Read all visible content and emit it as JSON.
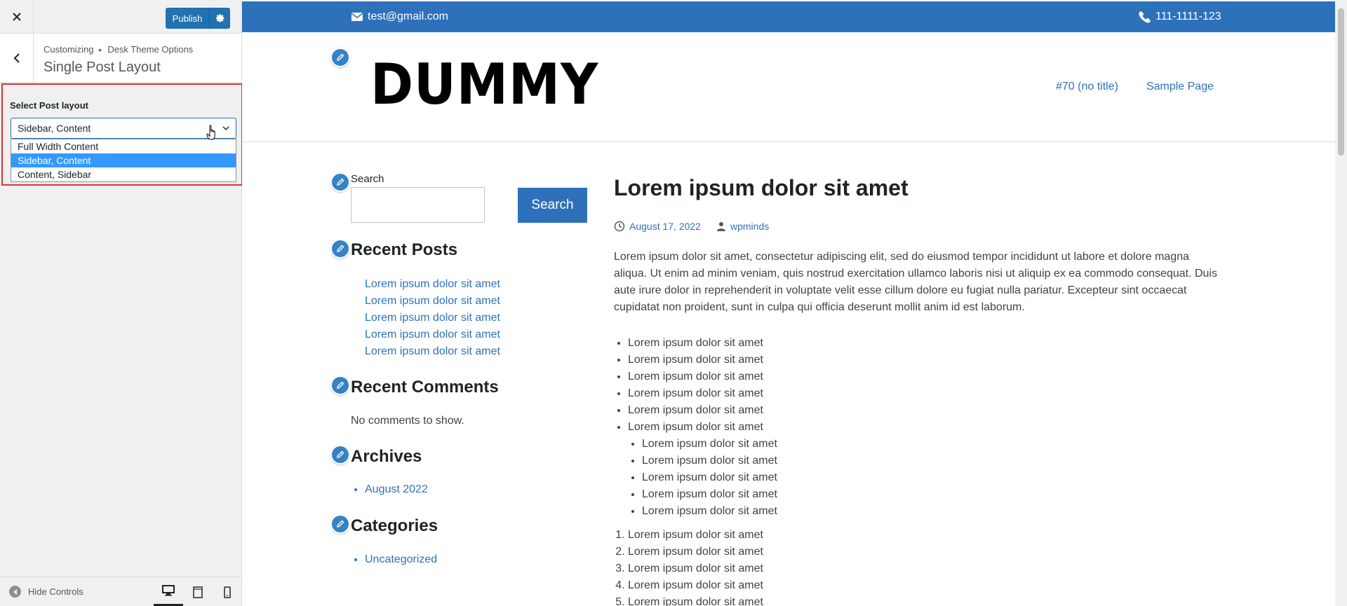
{
  "customizer": {
    "publish_label": "Publish",
    "breadcrumb": {
      "root": "Customizing",
      "separator": "▸",
      "parent": "Desk Theme Options"
    },
    "section_title": "Single Post Layout",
    "control_label": "Select Post layout",
    "select_value": "Sidebar, Content",
    "options": [
      {
        "label": "Full Width Content",
        "selected": false
      },
      {
        "label": "Sidebar, Content",
        "selected": true
      },
      {
        "label": "Content, Sidebar",
        "selected": false
      }
    ],
    "hide_controls_label": "Hide Controls",
    "devices": [
      "desktop-icon",
      "tablet-icon",
      "mobile-icon"
    ]
  },
  "site": {
    "email": "test@gmail.com",
    "phone": "111-1111-123",
    "logo": "DUMMY",
    "nav": [
      "#70 (no title)",
      "Sample Page"
    ],
    "accent_color": "#2e71bb"
  },
  "sidebar": {
    "search_label": "Search",
    "search_button": "Search",
    "recent_posts_title": "Recent Posts",
    "recent_posts": [
      "Lorem ipsum dolor sit amet",
      "Lorem ipsum dolor sit amet",
      "Lorem ipsum dolor sit amet",
      "Lorem ipsum dolor sit amet",
      "Lorem ipsum dolor sit amet"
    ],
    "recent_comments_title": "Recent Comments",
    "no_comments": "No comments to show.",
    "archives_title": "Archives",
    "archives": [
      "August 2022"
    ],
    "categories_title": "Categories",
    "categories": [
      "Uncategorized"
    ]
  },
  "post": {
    "title": "Lorem ipsum dolor sit amet",
    "date": "August 17, 2022",
    "author": "wpminds",
    "body": "Lorem ipsum dolor sit amet, consectetur adipiscing elit, sed do eiusmod tempor incididunt ut labore et dolore magna aliqua. Ut enim ad minim veniam, quis nostrud exercitation ullamco laboris nisi ut aliquip ex ea commodo consequat. Duis aute irure dolor in reprehenderit in voluptate velit esse cillum dolore eu fugiat nulla pariatur. Excepteur sint occaecat cupidatat non proident, sunt in culpa qui officia deserunt mollit anim id est laborum.",
    "ul_items": [
      "Lorem ipsum dolor sit amet",
      "Lorem ipsum dolor sit amet",
      "Lorem ipsum dolor sit amet",
      "Lorem ipsum dolor sit amet",
      "Lorem ipsum dolor sit amet",
      "Lorem ipsum dolor sit amet"
    ],
    "nested_items": [
      "Lorem ipsum dolor sit amet",
      "Lorem ipsum dolor sit amet",
      "Lorem ipsum dolor sit amet",
      "Lorem ipsum dolor sit amet",
      "Lorem ipsum dolor sit amet"
    ],
    "ol_items": [
      "Lorem ipsum dolor sit amet",
      "Lorem ipsum dolor sit amet",
      "Lorem ipsum dolor sit amet",
      "Lorem ipsum dolor sit amet",
      "Lorem ipsum dolor sit amet"
    ]
  }
}
